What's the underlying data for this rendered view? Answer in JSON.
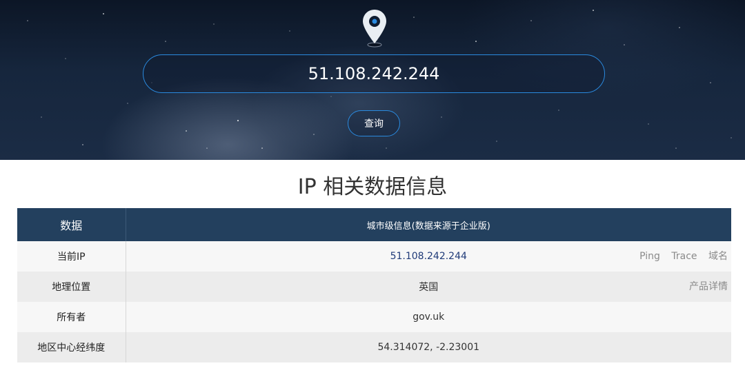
{
  "search": {
    "value": "51.108.242.244",
    "button_label": "查询"
  },
  "section": {
    "title": "IP 相关数据信息"
  },
  "table": {
    "header_key": "数据",
    "header_value": "城市级信息(数据来源于企业版)",
    "rows": [
      {
        "key": "当前IP",
        "value": "51.108.242.244"
      },
      {
        "key": "地理位置",
        "value": "英国"
      },
      {
        "key": "所有者",
        "value": "gov.uk"
      },
      {
        "key": "地区中心经纬度",
        "value": "54.314072, -2.23001"
      }
    ],
    "ip_actions": [
      "Ping",
      "Trace",
      "域名"
    ],
    "location_action": "产品详情"
  },
  "colors": {
    "accent": "#2a8be0",
    "table_header": "#23405e",
    "ip_link": "#1f3a78"
  },
  "icons": {
    "location_pin": "map-pin-icon"
  }
}
